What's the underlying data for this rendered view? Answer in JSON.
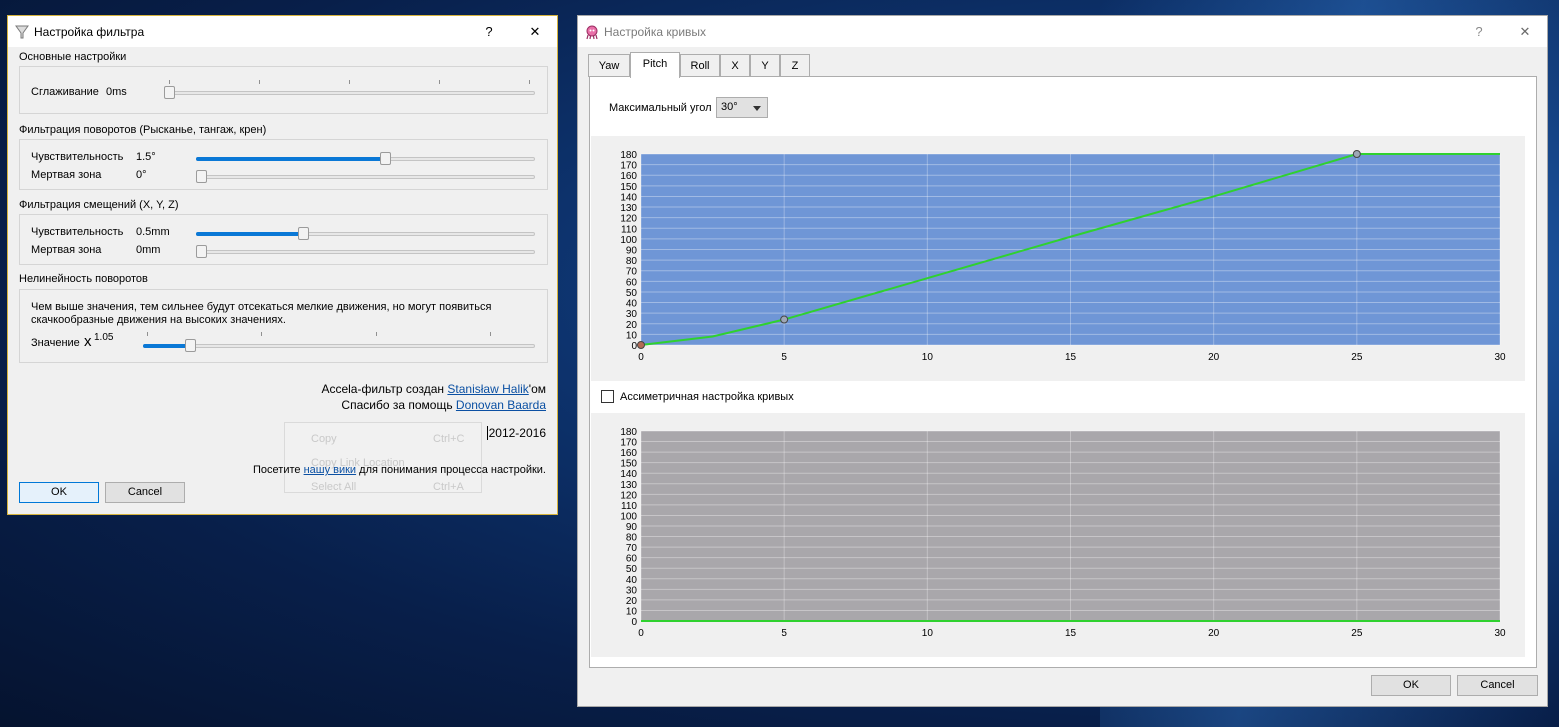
{
  "filter_window": {
    "title": "Настройка фильтра",
    "help_glyph": "?",
    "close_glyph": "✕",
    "basic": {
      "group_label": "Основные настройки",
      "smoothing_label": "Сглаживание",
      "smoothing_value": "0ms",
      "smoothing_level": 0
    },
    "rotation": {
      "group_label": "Фильтрация поворотов (Рысканье, тангаж, крен)",
      "sensitivity_label": "Чувствительность",
      "sensitivity_value": "1.5°",
      "sensitivity_level": 0.56,
      "deadzone_label": "Мертвая зона",
      "deadzone_value": "0°",
      "deadzone_level": 0
    },
    "translation": {
      "group_label": "Фильтрация смещений (X, Y, Z)",
      "sensitivity_label": "Чувствительность",
      "sensitivity_value": "0.5mm",
      "sensitivity_level": 0.31,
      "deadzone_label": "Мертвая зона",
      "deadzone_value": "0mm",
      "deadzone_level": 0
    },
    "nonlinearity": {
      "group_label": "Нелинейность поворотов",
      "description": "Чем выше значения, тем сильнее будут отсекаться мелкие движения, но могут появиться скачкообразные движения на высоких значениях.",
      "value_label": "Значение",
      "value_base": "x",
      "value_exp": "1.05",
      "level": 0.11
    },
    "credits": {
      "line1_prefix": "Accela-фильтр создан ",
      "line1_link": "Stanisław Halik",
      "line1_suffix": "'ом",
      "line2_prefix": "Спасибо за помощь ",
      "line2_link": "Donovan Baarda",
      "years": "2012-2016",
      "wiki_prefix": "Посетите ",
      "wiki_link": "нашу вики",
      "wiki_suffix": " для понимания процесса настройки."
    },
    "context_menu": [
      {
        "label": "Copy",
        "shortcut": "Ctrl+C"
      },
      {
        "label": "Copy Link Location",
        "shortcut": ""
      },
      {
        "label": "Select All",
        "shortcut": "Ctrl+A"
      }
    ],
    "ok_label": "OK",
    "cancel_label": "Cancel"
  },
  "curves_window": {
    "title": "Настройка кривых",
    "help_glyph": "?",
    "close_glyph": "✕",
    "tabs": [
      "Yaw",
      "Pitch",
      "Roll",
      "X",
      "Y",
      "Z"
    ],
    "active_tab": "Pitch",
    "max_angle_label": "Максимальный угол",
    "max_angle_value": "30°",
    "asymmetric_label": "Ассиметричная настройка кривых",
    "ok_label": "OK",
    "cancel_label": "Cancel"
  },
  "chart_data": [
    {
      "type": "line",
      "title": "",
      "xlabel": "",
      "ylabel": "",
      "xlim": [
        0,
        30
      ],
      "ylim": [
        0,
        180
      ],
      "x_ticks": [
        "0",
        "5",
        "10",
        "15",
        "20",
        "25",
        "30"
      ],
      "y_ticks": [
        "0",
        "10",
        "20",
        "30",
        "40",
        "50",
        "60",
        "70",
        "80",
        "90",
        "100",
        "110",
        "120",
        "130",
        "140",
        "150",
        "160",
        "170",
        "180"
      ],
      "background": "#6f96d6",
      "line_color": "#2fd12f",
      "grid": true,
      "series": [
        {
          "name": "",
          "x": [
            0,
            2.5,
            5,
            10,
            15,
            20,
            25,
            30
          ],
          "y": [
            0,
            8,
            24,
            63,
            102,
            140,
            180,
            180
          ]
        }
      ],
      "control_points": [
        {
          "x": 0,
          "y": 0
        },
        {
          "x": 5,
          "y": 24
        },
        {
          "x": 25,
          "y": 180
        }
      ]
    },
    {
      "type": "line",
      "title": "",
      "xlabel": "",
      "ylabel": "",
      "xlim": [
        0,
        30
      ],
      "ylim": [
        0,
        180
      ],
      "x_ticks": [
        "0",
        "5",
        "10",
        "15",
        "20",
        "25",
        "30"
      ],
      "y_ticks": [
        "0",
        "10",
        "20",
        "30",
        "40",
        "50",
        "60",
        "70",
        "80",
        "90",
        "100",
        "110",
        "120",
        "130",
        "140",
        "150",
        "160",
        "170",
        "180"
      ],
      "background": "#a9a7ab",
      "line_color": "#2fd12f",
      "grid": true,
      "series": [
        {
          "name": "",
          "x": [
            0,
            30
          ],
          "y": [
            0,
            0
          ]
        }
      ]
    }
  ]
}
